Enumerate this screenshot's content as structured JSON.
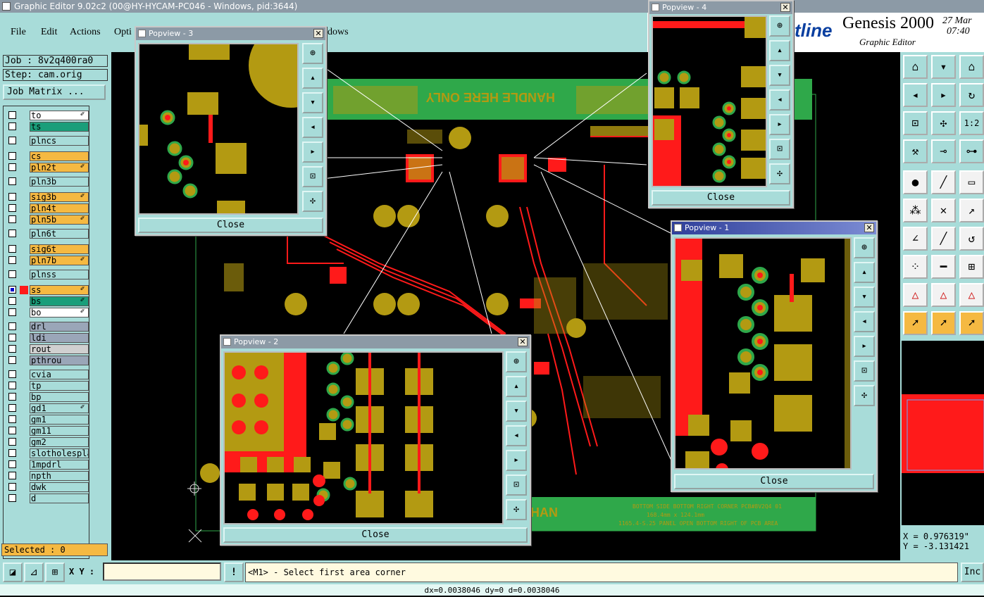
{
  "window": {
    "title": "Graphic Editor 9.02c2 (00@HY-HYCAM-PC046 - Windows, pid:3644)"
  },
  "menu": {
    "file": "File",
    "edit": "Edit",
    "actions": "Actions",
    "options": "Opti",
    "windows": "dows"
  },
  "logo": {
    "brand": "tline",
    "product": "Genesis 2000",
    "subtitle": "Graphic Editor",
    "date_line1": "27 Mar",
    "date_line2": "07:40"
  },
  "job": {
    "job": "Job : 8v2q400ra0",
    "step": "Step: cam.orig",
    "matrix_button": "Job Matrix ..."
  },
  "layers": [
    {
      "name": "to",
      "color": "#ffffff",
      "checked": false,
      "tag": "✐"
    },
    {
      "name": "ts",
      "color": "#1a9e7a",
      "checked": false,
      "tag": ""
    },
    {
      "name": "plncs",
      "color": "#a8dcd9",
      "checked": false,
      "tag": ""
    },
    {
      "name": "cs",
      "color": "#f5b942",
      "checked": false,
      "tag": ""
    },
    {
      "name": "pln2t",
      "color": "#f5b942",
      "checked": false,
      "tag": "✐"
    },
    {
      "name": "pln3b",
      "color": "#a8dcd9",
      "checked": false,
      "tag": ""
    },
    {
      "name": "sig3b",
      "color": "#f5b942",
      "checked": false,
      "tag": "✐"
    },
    {
      "name": "pln4t",
      "color": "#f5b942",
      "checked": false,
      "tag": ""
    },
    {
      "name": "pln5b",
      "color": "#f5b942",
      "checked": false,
      "tag": "✐"
    },
    {
      "name": "pln6t",
      "color": "#a8dcd9",
      "checked": false,
      "tag": ""
    },
    {
      "name": "sig6t",
      "color": "#f5b942",
      "checked": false,
      "tag": ""
    },
    {
      "name": "pln7b",
      "color": "#f5b942",
      "checked": false,
      "tag": "✐"
    },
    {
      "name": "plnss",
      "color": "#a8dcd9",
      "checked": false,
      "tag": ""
    },
    {
      "name": "ss",
      "color": "#f5b942",
      "checked": true,
      "tag": "✐"
    },
    {
      "name": "bs",
      "color": "#1a9e7a",
      "checked": false,
      "tag": "✐"
    },
    {
      "name": "bo",
      "color": "#ffffff",
      "checked": false,
      "tag": "✐"
    },
    {
      "name": "drl",
      "color": "#9aa6b8",
      "checked": false,
      "tag": ""
    },
    {
      "name": "ldi",
      "color": "#9aa6b8",
      "checked": false,
      "tag": ""
    },
    {
      "name": "rout",
      "color": "#d0d0d0",
      "checked": false,
      "tag": ""
    },
    {
      "name": "pthrou",
      "color": "#9aa6b8",
      "checked": false,
      "tag": ""
    },
    {
      "name": "cvia",
      "color": "#a8dcd9",
      "checked": false,
      "tag": ""
    },
    {
      "name": "tp",
      "color": "#a8dcd9",
      "checked": false,
      "tag": ""
    },
    {
      "name": "bp",
      "color": "#a8dcd9",
      "checked": false,
      "tag": ""
    },
    {
      "name": "gd1",
      "color": "#a8dcd9",
      "checked": false,
      "tag": "✐"
    },
    {
      "name": "gm1",
      "color": "#a8dcd9",
      "checked": false,
      "tag": ""
    },
    {
      "name": "gm11",
      "color": "#a8dcd9",
      "checked": false,
      "tag": ""
    },
    {
      "name": "gm2",
      "color": "#a8dcd9",
      "checked": false,
      "tag": ""
    },
    {
      "name": "slotholespla",
      "color": "#a8dcd9",
      "checked": false,
      "tag": ""
    },
    {
      "name": "1mpdrl",
      "color": "#a8dcd9",
      "checked": false,
      "tag": ""
    },
    {
      "name": "npth",
      "color": "#a8dcd9",
      "checked": false,
      "tag": ""
    },
    {
      "name": "dwk",
      "color": "#a8dcd9",
      "checked": false,
      "tag": ""
    },
    {
      "name": "d",
      "color": "#a8dcd9",
      "checked": false,
      "tag": ""
    }
  ],
  "selected": "Selected : 0",
  "board": {
    "handle_text_top": "HANDLE HERE ONLY",
    "handle_text_bottom": "HAN",
    "silk_line1": "BOTTOM SIDE BOTTOM RIGHT CORNER PCB#8V2Q4 01",
    "silk_line2": "168.4mm x 124.1mm",
    "silk_line3": "1165.4-S.25  PANEL OPEN BOTTOM RIGHT OF PCB AREA"
  },
  "popviews": {
    "p1": {
      "title": "Popview - 1",
      "close": "Close"
    },
    "p2": {
      "title": "Popview - 2",
      "close": "Close"
    },
    "p3": {
      "title": "Popview - 3",
      "close": "Close"
    },
    "p4": {
      "title": "Popview - 4",
      "close": "Close"
    }
  },
  "coords": {
    "x": "X = 0.976319\"",
    "y": "Y = -3.131421"
  },
  "status": {
    "xy_label": "X Y :",
    "xy_value": "",
    "prompt": "<M1> - Select first area corner",
    "right_button": "Inc",
    "bottom_line": "dx=0.0038046 dy=0 d=0.0038046"
  },
  "colors": {
    "teal": "#a8dcd9",
    "pad": "#b39a12",
    "trace": "#ff1a1a",
    "mask": "#2fa84a",
    "orange": "#f5b942"
  }
}
